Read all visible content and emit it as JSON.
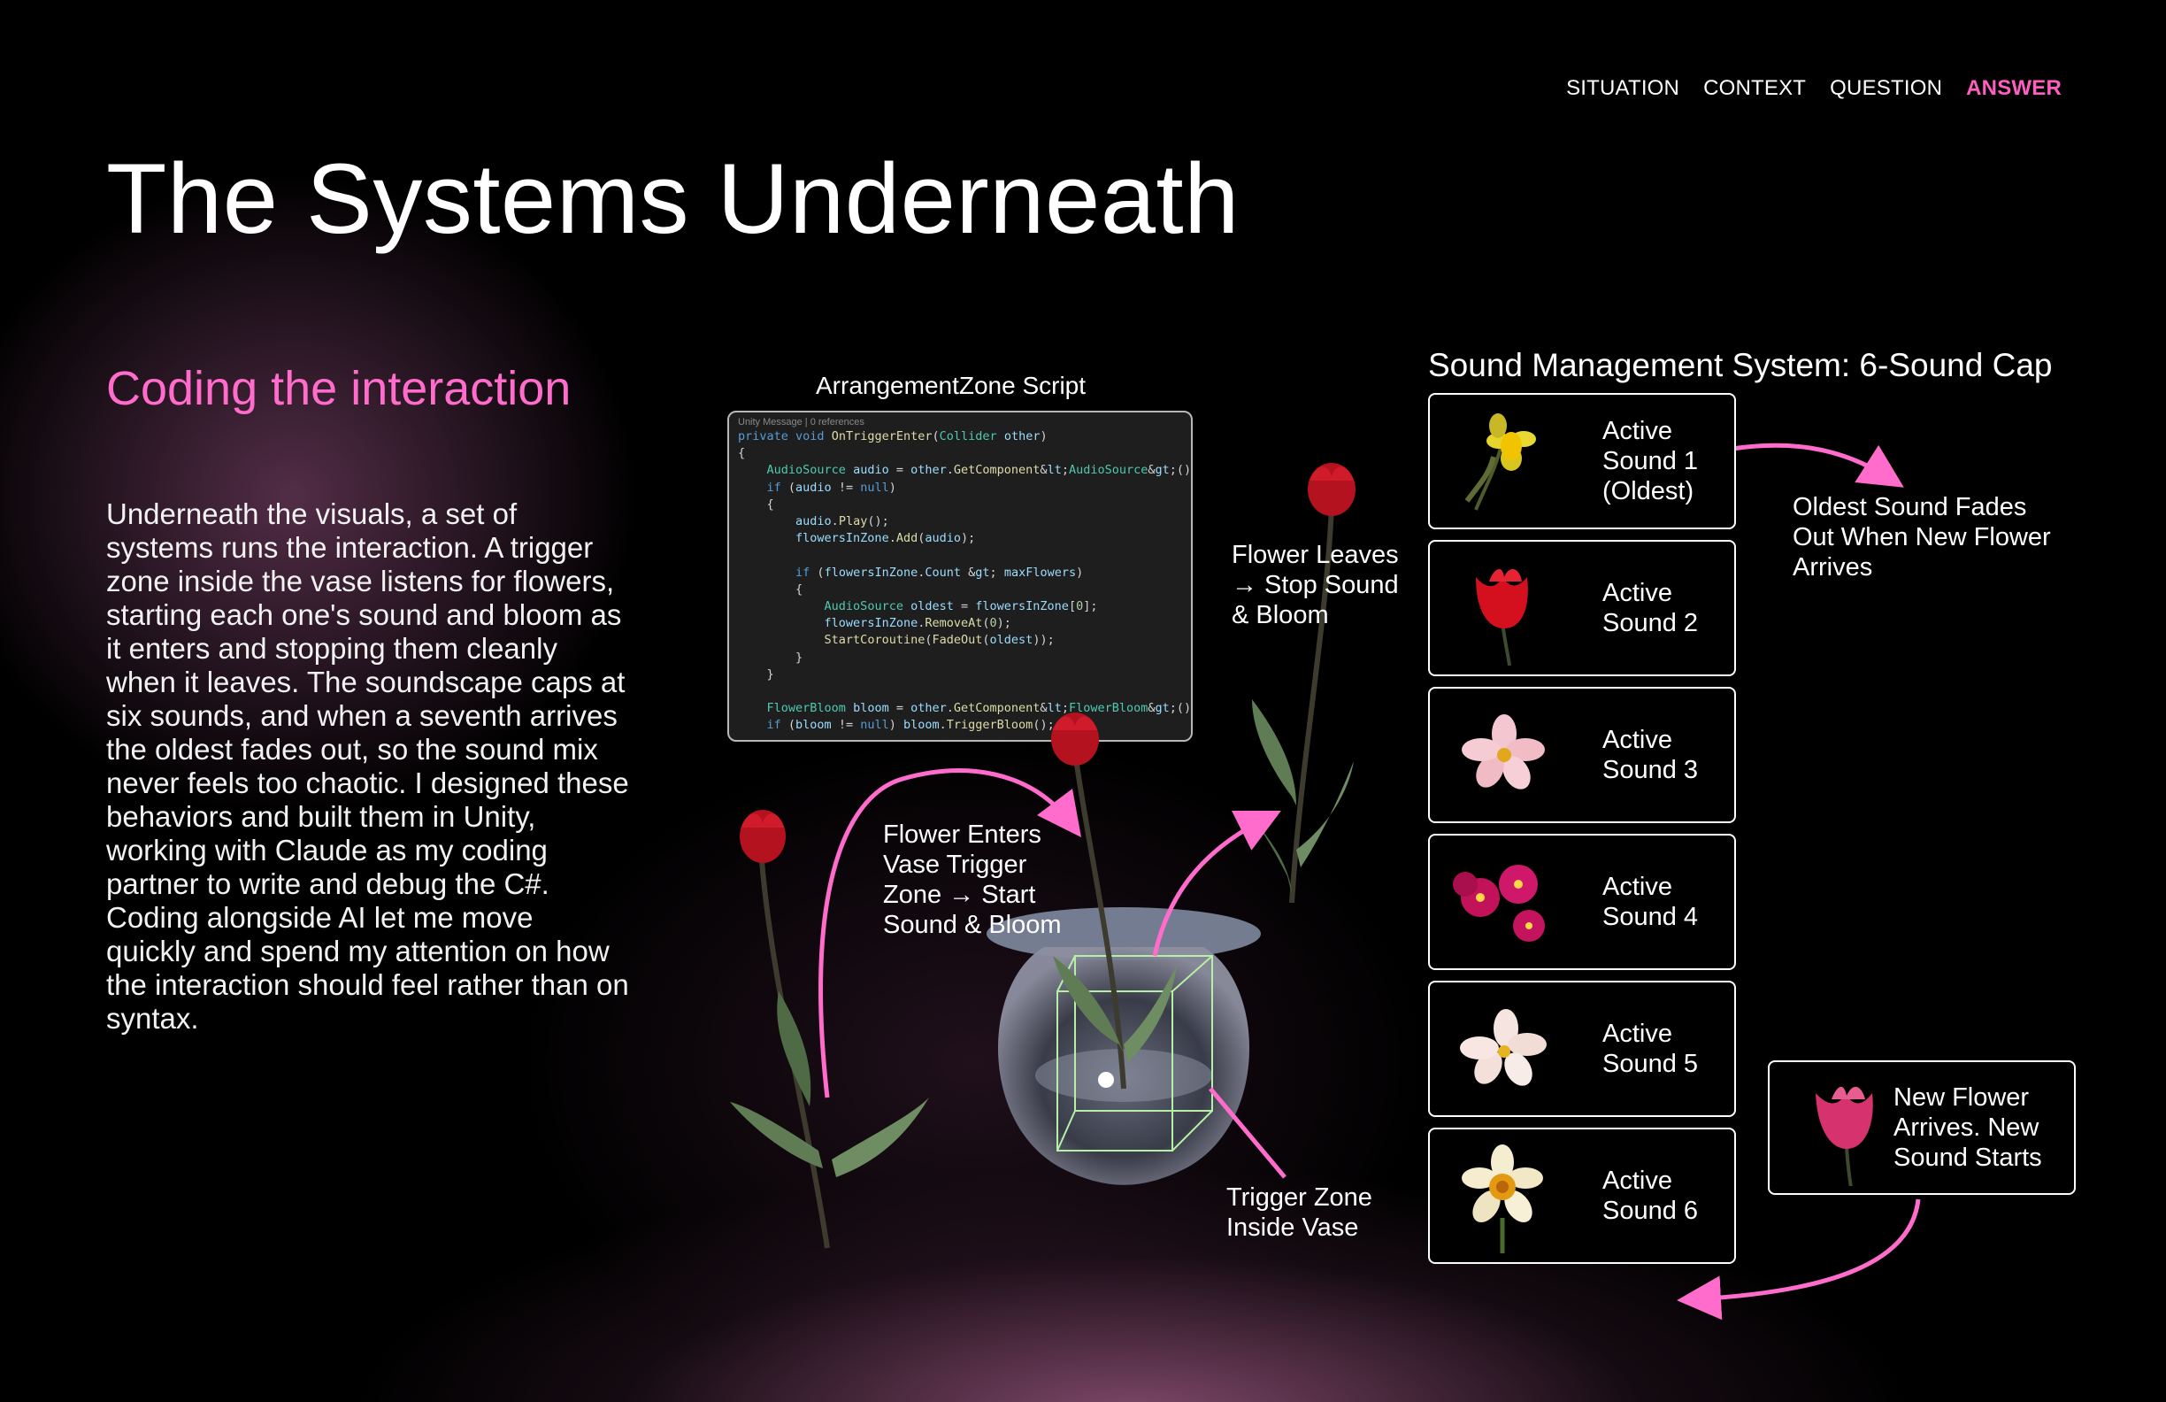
{
  "nav": {
    "items": [
      {
        "label": "SITUATION"
      },
      {
        "label": "CONTEXT"
      },
      {
        "label": "QUESTION"
      },
      {
        "label": "ANSWER"
      }
    ],
    "active_color": "#ff5ec1"
  },
  "page": {
    "title": "The Systems Underneath",
    "subtitle": "Coding the interaction",
    "body": "Underneath the visuals, a set of systems runs the interaction. A trigger zone inside the vase listens for flowers, starting each one's sound and bloom as it enters and stopping them cleanly when it leaves. The soundscape caps at six sounds, and when a seventh arrives the oldest fades out, so the sound mix never feels too chaotic. I designed these behaviors and built them in Unity, working with Claude as my coding partner to write and debug the C#. Coding alongside AI let me move quickly and spend my attention on how the interaction should feel rather than on syntax."
  },
  "script": {
    "label": "ArrangementZone Script",
    "meta": "Unity Message | 0 references",
    "lines": [
      "private void OnTriggerEnter(Collider other)",
      "{",
      "    AudioSource audio = other.GetComponent<AudioSource>();",
      "    if (audio != null)",
      "    {",
      "        audio.Play();",
      "        flowersInZone.Add(audio);",
      "",
      "        if (flowersInZone.Count > maxFlowers)",
      "        {",
      "            AudioSource oldest = flowersInZone[0];",
      "            flowersInZone.RemoveAt(0);",
      "            StartCoroutine(FadeOut(oldest));",
      "        }",
      "    }",
      "",
      "    FlowerBloom bloom = other.GetComponent<FlowerBloom>();",
      "    if (bloom != null) bloom.TriggerBloom();"
    ]
  },
  "diagram": {
    "enter_label": "Flower Enters Vase Trigger Zone → Start Sound & Bloom",
    "leave_label": "Flower Leaves → Stop Sound & Bloom",
    "zone_label": "Trigger Zone Inside Vase",
    "accent": "#ff6ccb"
  },
  "sound_system": {
    "title": "Sound Management System: 6-Sound Cap",
    "cards": [
      {
        "label": "Active Sound 1 (Oldest)",
        "flower": "daffodil-icon"
      },
      {
        "label": "Active Sound 2",
        "flower": "red-tulip-icon"
      },
      {
        "label": "Active Sound 3",
        "flower": "pink-cosmos-icon"
      },
      {
        "label": "Active Sound 4",
        "flower": "magenta-primrose-icon"
      },
      {
        "label": "Active Sound 5",
        "flower": "pale-cosmos-icon"
      },
      {
        "label": "Active Sound 6",
        "flower": "narcissus-icon"
      }
    ],
    "fade_label": "Oldest Sound Fades Out When New Flower Arrives",
    "new_card_label": "New Flower Arrives. New Sound Starts"
  }
}
